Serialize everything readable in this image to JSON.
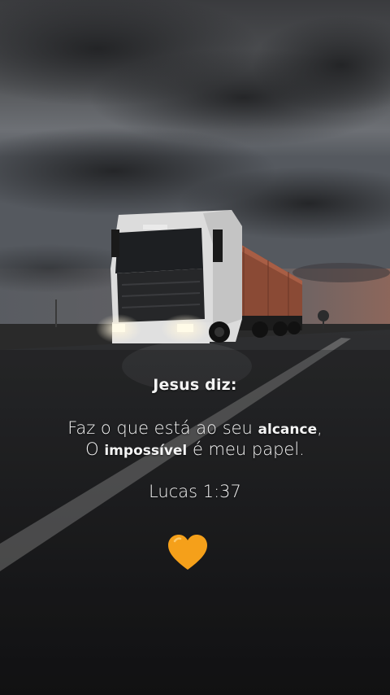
{
  "quote": {
    "speaker": "Jesus diz:",
    "line1_a": "Faz o que está ao seu ",
    "line1_emph": "alcance",
    "line1_b": ",",
    "line2_a": "O ",
    "line2_emph": "impossível",
    "line2_b": " é meu papel.",
    "reference": "Lucas 1:37"
  },
  "icons": {
    "heart": "orange-heart-icon"
  },
  "colors": {
    "heart": "#f5a01a",
    "text": "#f4f4f4",
    "trailer": "#8a4a35"
  }
}
